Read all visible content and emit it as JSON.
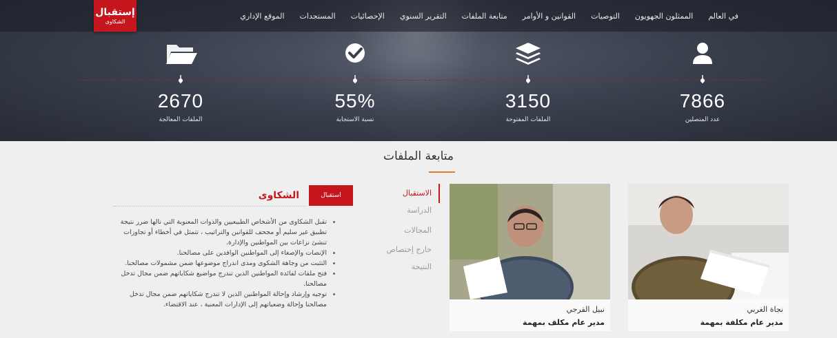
{
  "nav": {
    "items": [
      "الموقع الإداري",
      "المستجدات",
      "الإحصائيات",
      "التقرير السنوي",
      "متابعة الملفات",
      "القوانين و الأوامر",
      "التوصيات",
      "الممثلون الجهويون",
      "في العالم"
    ],
    "brand": {
      "main": "إستقبال",
      "sub": "الشكاوى"
    }
  },
  "stats": [
    {
      "value": "2670",
      "label": "الملفات المعالجة",
      "icon": "folder-open-icon"
    },
    {
      "value": "55%",
      "label": "نسبة الاستجابة",
      "icon": "check-circle-icon"
    },
    {
      "value": "3150",
      "label": "الملفات المفتوحة",
      "icon": "layers-icon"
    },
    {
      "value": "7866",
      "label": "عدد المتصلين",
      "icon": "user-icon"
    }
  ],
  "section": {
    "title": "متابعة الملفات",
    "people": [
      {
        "name": "نجاة الغربي",
        "role": "مدير عام مكلفة بمهمة"
      },
      {
        "name": "نبيل القرجي",
        "role": "مدير عام مكلف بمهمة"
      }
    ],
    "tabs": [
      "الاستقبال",
      "الدراسة",
      "المجالات",
      "خارج إختصاص",
      "النتيجة"
    ],
    "complaints": {
      "title": "الشكاوى",
      "button": "استقبال",
      "items": [
        "تقبل الشكاوى من الأشخاص الطبيعيين والذوات المعنوية التي نالها ضرر نتيجة تطبيق غير سليم أو مجحف للقوانين والتراتيب ، تتمثل في أخطاء أو تجاوزات تنشئ نزاعات بين المواطنين والإدارة.",
        "الإنصات والإصغاء إلى المواطنين الوافدين على مصالحنا.",
        "التثبت من وجاهة الشكوى ومدى اندراج موضوعها ضمن مشمولات مصالحنا.",
        "فتح ملفات لفائدة المواطنين الذين تندرج مواضيع شكاياتهم ضمن مجال تدخل مصالحنا.",
        "توجيه وإرشاد وإحالة المواطنين الذين لا تندرج شكاياتهم ضمن مجال تدخل مصالحنا وإحالة وضعياتهم إلى الإدارات المعنية ، عند الاقتضاء."
      ]
    }
  },
  "colors": {
    "accent": "#c4161c",
    "underline": "#e6782a",
    "hero": "#3a404d",
    "section_bg": "#efefef"
  }
}
